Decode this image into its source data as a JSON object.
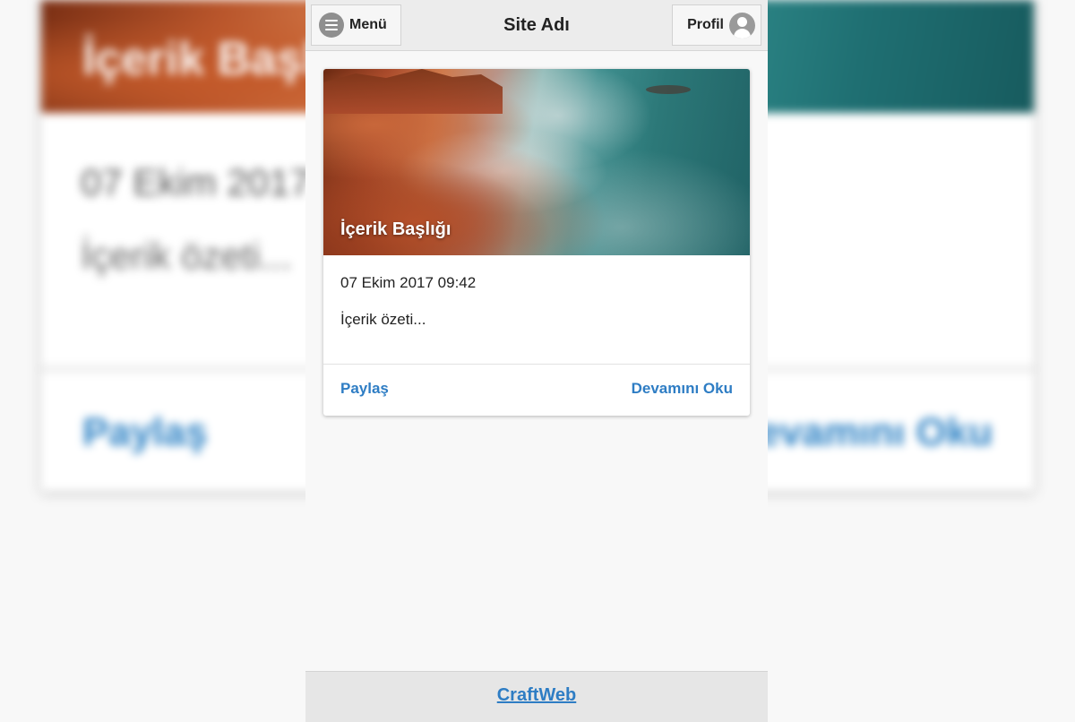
{
  "header": {
    "menu_label": "Menü",
    "site_title": "Site Adı",
    "profile_label": "Profil"
  },
  "card": {
    "title": "İçerik Başlığı",
    "date": "07 Ekim 2017 09:42",
    "excerpt": "İçerik özeti...",
    "share_label": "Paylaş",
    "read_more_label": "Devamını Oku"
  },
  "footer": {
    "link_label": "CraftWeb"
  },
  "icons": {
    "menu": "hamburger-circle-icon",
    "profile": "user-avatar-icon"
  },
  "colors": {
    "link": "#2e7dc4",
    "header_bg": "#ececec",
    "footer_bg": "#e6e6e6",
    "page_bg": "#f8f8f8"
  }
}
